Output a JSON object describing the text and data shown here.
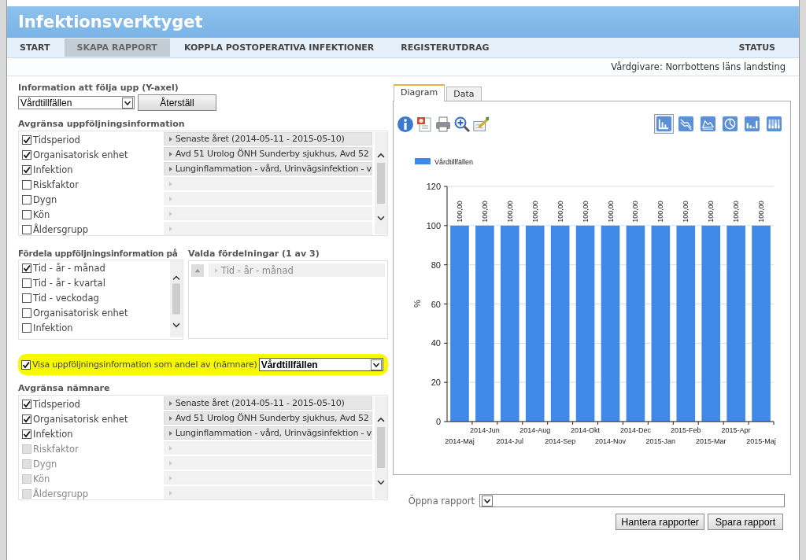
{
  "app": {
    "title": "Infektionsverktyget"
  },
  "nav": [
    {
      "label": "START",
      "selected": false
    },
    {
      "label": "SKAPA RAPPORT",
      "selected": true
    },
    {
      "label": "KOPPLA POSTOPERATIVA INFEKTIONER",
      "selected": false
    },
    {
      "label": "REGISTERUTDRAG",
      "selected": false
    }
  ],
  "nav_right": {
    "label": "STATUS"
  },
  "caregiver": "Vårdgivare: Norrbottens läns landsting",
  "y_axis_section": {
    "label": "Information att följa upp (Y-axel)",
    "select": "Vårdtillfällen",
    "reset_button": "Återställ"
  },
  "limit_section": {
    "title": "Avgränsa uppföljningsinformation",
    "rows": [
      {
        "label": "Tidsperiod",
        "checked": true,
        "disabled": false,
        "filter": "Senaste året (2014-05-11 - 2015-05-10)"
      },
      {
        "label": "Organisatorisk enhet",
        "checked": true,
        "disabled": false,
        "filter": "Avd 51 Urolog ÖNH Sunderby sjukhus, Avd 52"
      },
      {
        "label": "Infektion",
        "checked": true,
        "disabled": false,
        "filter": "Lunginflammation - vård, Urinvägsinfektion - v"
      },
      {
        "label": "Riskfaktor",
        "checked": false,
        "disabled": false
      },
      {
        "label": "Dygn",
        "checked": false,
        "disabled": false
      },
      {
        "label": "Kön",
        "checked": false,
        "disabled": false
      },
      {
        "label": "Åldersgrupp",
        "checked": false,
        "disabled": false
      }
    ]
  },
  "distribute_section": {
    "title": "Fördela uppföljningsinformation på",
    "items": [
      {
        "label": "Tid - år - månad",
        "checked": true
      },
      {
        "label": "Tid - år - kvartal",
        "checked": false
      },
      {
        "label": "Tid - veckodag",
        "checked": false
      },
      {
        "label": "Organisatorisk enhet",
        "checked": false
      },
      {
        "label": "Infektion",
        "checked": false
      }
    ]
  },
  "selected_section": {
    "title": "Valda fördelningar (1 av 3)",
    "items": [
      {
        "label": "Tid - år - månad"
      }
    ]
  },
  "share_option": {
    "checked": true,
    "highlighted": true,
    "label": "Visa uppföljningsinformation som andel av (nämnare)",
    "select": "Vårdtillfällen"
  },
  "denominator_section": {
    "title": "Avgränsa nämnare",
    "rows": [
      {
        "label": "Tidsperiod",
        "checked": true,
        "disabled": false,
        "filter": "Senaste året (2014-05-11 - 2015-05-10)"
      },
      {
        "label": "Organisatorisk enhet",
        "checked": true,
        "disabled": false,
        "filter": "Avd 51 Urolog ÖNH Sunderby sjukhus, Avd 52"
      },
      {
        "label": "Infektion",
        "checked": true,
        "disabled": false,
        "filter": "Lunginflammation - vård, Urinvägsinfektion - v"
      },
      {
        "label": "Riskfaktor",
        "checked": false,
        "disabled": true
      },
      {
        "label": "Dygn",
        "checked": false,
        "disabled": true
      },
      {
        "label": "Kön",
        "checked": false,
        "disabled": true
      },
      {
        "label": "Åldersgrupp",
        "checked": false,
        "disabled": true
      }
    ]
  },
  "chart_panel": {
    "tabs": [
      {
        "label": "Diagram",
        "selected": true
      },
      {
        "label": "Data",
        "selected": false
      }
    ],
    "tools": [
      {
        "kind": "info"
      },
      {
        "kind": "document"
      },
      {
        "kind": "print"
      },
      {
        "kind": "zoom"
      },
      {
        "kind": "edit"
      }
    ],
    "chart_types": [
      {
        "kind": "bar",
        "selected": true
      },
      {
        "kind": "line",
        "selected": false
      },
      {
        "kind": "area",
        "selected": false
      },
      {
        "kind": "pie",
        "selected": false
      },
      {
        "kind": "stacked",
        "selected": false
      },
      {
        "kind": "stacked100",
        "selected": false
      }
    ],
    "chart_data": {
      "type": "bar",
      "ylabel": "%",
      "categories": [
        "2014-Maj",
        "2014-Jun",
        "2014-Jul",
        "2014-Aug",
        "2014-Sep",
        "2014-Okt",
        "2014-Nov",
        "2014-Dec",
        "2015-Jan",
        "2015-Feb",
        "2015-Mar",
        "2015-Apr",
        "2015-Maj"
      ],
      "series": [
        {
          "name": "Vårdtillfällen",
          "color": "#3f8ae8",
          "values": [
            100,
            100,
            100,
            100,
            100,
            100,
            100,
            100,
            100,
            100,
            100,
            100,
            100
          ]
        }
      ],
      "grid": true,
      "ylim": [
        0,
        120
      ],
      "yticks": [
        0,
        20,
        40,
        60,
        80,
        100,
        120
      ],
      "value_labels": [
        "100,00",
        "100,00",
        "100,00",
        "100,00",
        "100,00",
        "100,00",
        "100,00",
        "100,00",
        "100,00",
        "100,00",
        "100,00",
        "100,00",
        "100,00"
      ]
    }
  },
  "open_report": {
    "label": "Öppna rapport"
  },
  "buttons": [
    "Hantera rapporter",
    "Spara rapport"
  ]
}
